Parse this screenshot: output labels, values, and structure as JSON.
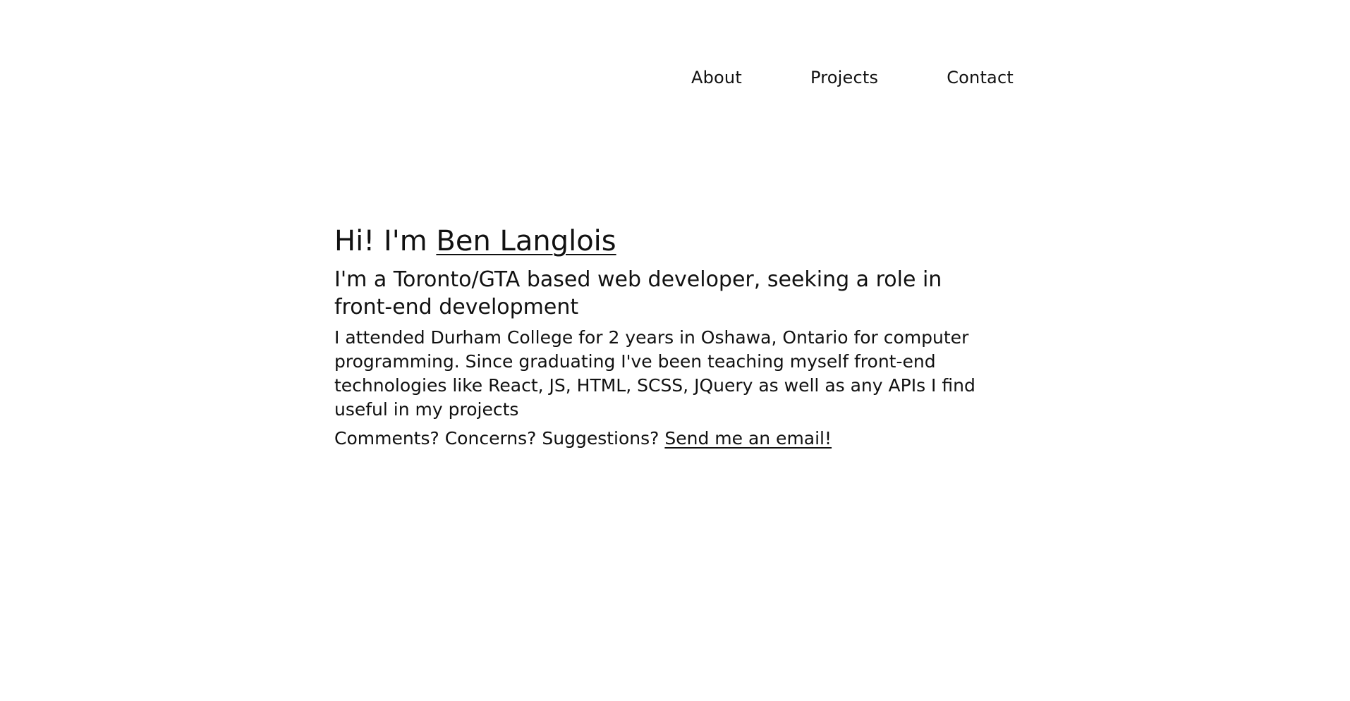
{
  "nav": {
    "items": [
      {
        "label": "About"
      },
      {
        "label": "Projects"
      },
      {
        "label": "Contact"
      }
    ]
  },
  "hero": {
    "greeting_prefix": "Hi! I'm ",
    "name": "Ben Langlois",
    "subheading": "I'm a Toronto/GTA based web developer, seeking a role in front-end development",
    "bio": "I attended Durham College for 2 years in Oshawa, Ontario for computer programming. Since graduating I've been teaching myself front-end technologies like React, JS, HTML, SCSS, JQuery as well as any APIs I find useful in my projects",
    "contact_prefix": "Comments? Concerns? Suggestions? ",
    "email_link_text": "Send me an email!"
  },
  "colors": {
    "background": "#ffffff",
    "text": "#111111"
  }
}
